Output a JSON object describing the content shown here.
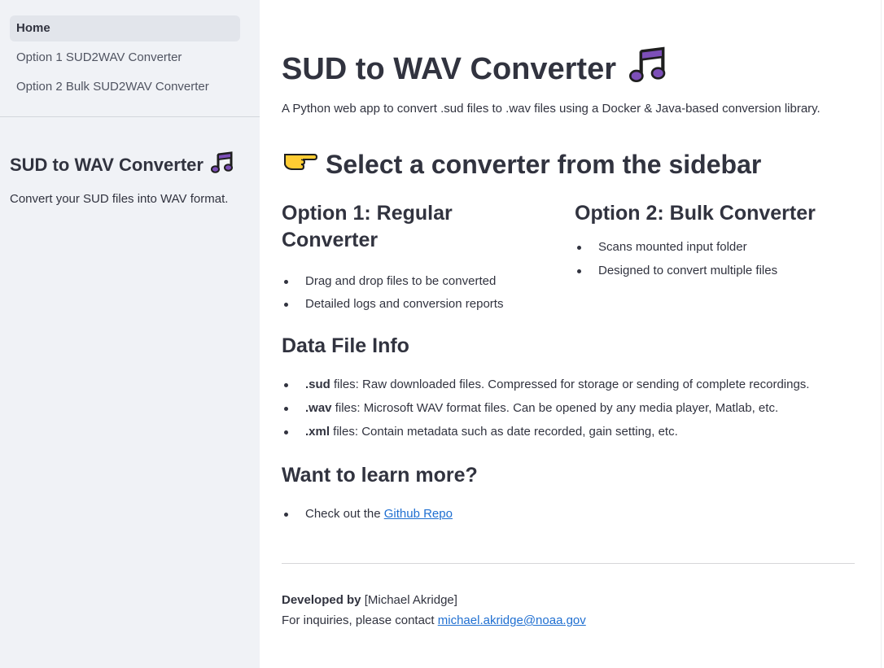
{
  "sidebar": {
    "nav": [
      {
        "label": "Home",
        "active": true
      },
      {
        "label": "Option 1 SUD2WAV Converter",
        "active": false
      },
      {
        "label": "Option 2 Bulk SUD2WAV Converter",
        "active": false
      }
    ],
    "title": "SUD to WAV Converter",
    "title_icon": "music-note-icon",
    "description": "Convert your SUD files into WAV format."
  },
  "main": {
    "title": "SUD to WAV Converter",
    "title_icon": "music-note-icon",
    "subtitle": "A Python web app to convert .sud files to .wav files using a Docker & Java-based conversion library.",
    "select_heading": "Select a converter from the sidebar",
    "select_icon": "pointing-hand-icon",
    "option1": {
      "heading": "Option 1: Regular Converter",
      "items": [
        "Drag and drop files to be converted",
        "Detailed logs and conversion reports"
      ]
    },
    "option2": {
      "heading": "Option 2: Bulk Converter",
      "items": [
        "Scans mounted input folder",
        "Designed to convert multiple files"
      ]
    },
    "data_info": {
      "heading": "Data File Info",
      "items": [
        {
          "bold": ".sud",
          "text": " files: Raw downloaded files. Compressed for storage or sending of complete recordings."
        },
        {
          "bold": ".wav",
          "text": " files: Microsoft WAV format files. Can be opened by any media player, Matlab, etc."
        },
        {
          "bold": ".xml",
          "text": " files: Contain metadata such as date recorded, gain setting, etc."
        }
      ]
    },
    "learn_more": {
      "heading": "Want to learn more?",
      "prefix": "Check out the ",
      "link_text": "Github Repo"
    },
    "footer": {
      "developed_label": "Developed by",
      "developer": " [Michael Akridge]",
      "contact_prefix": "For inquiries, please contact ",
      "contact_email": "michael.akridge@noaa.gov"
    }
  },
  "colors": {
    "sidebar_bg": "#f0f2f6",
    "text": "#31333f",
    "link": "#1f6fd1",
    "note_icon": "#7d4fb8"
  }
}
